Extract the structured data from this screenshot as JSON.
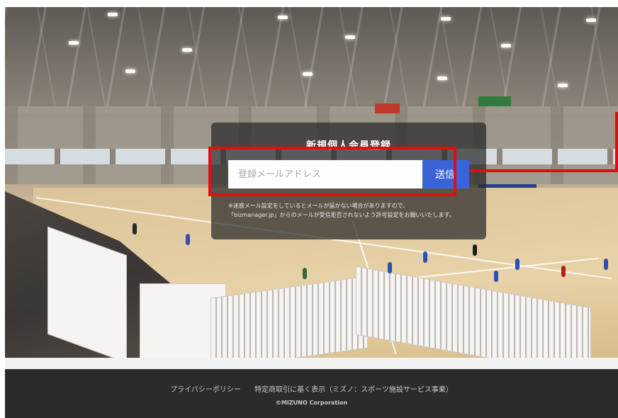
{
  "form": {
    "title": "新規個人会員登録",
    "email_placeholder": "登録メールアドレス",
    "email_value": "",
    "submit_label": "送信",
    "notice_line1": "※迷惑メール設定をしているとメールが届かない場合がありますので、",
    "notice_line2": "「bizmanager.jp」からのメールが受信拒否されないよう許可設定をお願いいたします。"
  },
  "footer": {
    "privacy_link": "プライバシーポリシー",
    "legal_link": "特定商取引に基く表示（ミズノ：スポーツ施設サービス事業）",
    "copyright": "©MIZUNO Corporation"
  },
  "colors": {
    "highlight": "#e20d0d",
    "submit_button": "#3b63d8",
    "footer_bg": "#2b2b2b"
  },
  "icons": {
    "hero": "arena-photo"
  }
}
